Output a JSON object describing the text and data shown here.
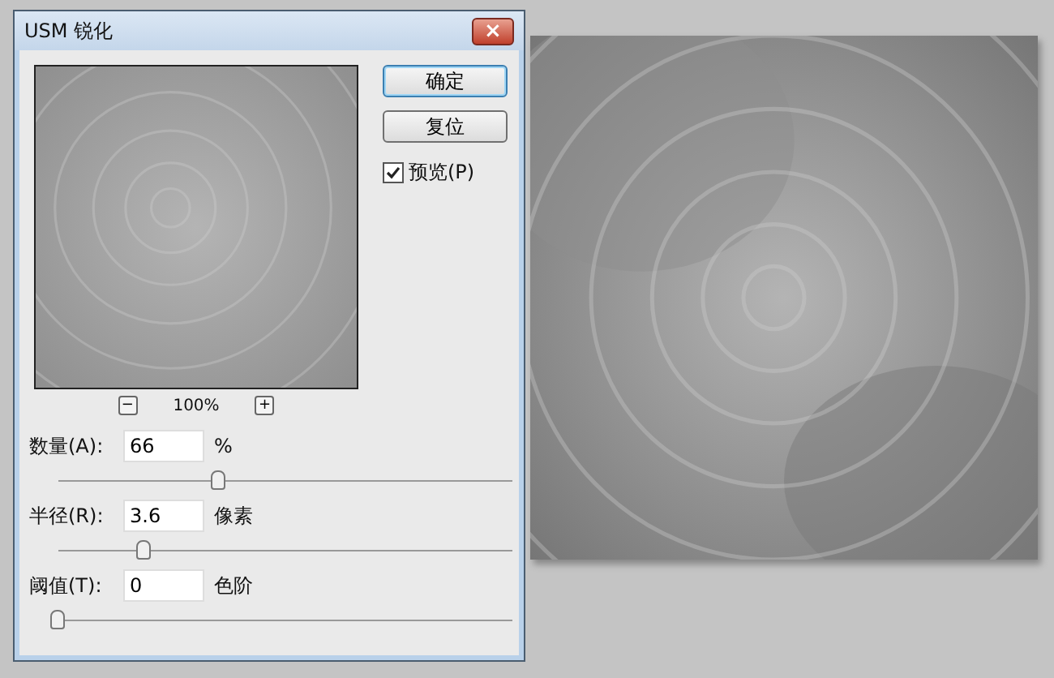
{
  "window": {
    "title": "USM 锐化",
    "close": "×"
  },
  "buttons": [
    {
      "label": "确定",
      "default": true
    },
    {
      "label": "复位",
      "default": false
    }
  ],
  "preview_option": {
    "label": "预览(P)",
    "checked": true
  },
  "zoom": {
    "minus": "−",
    "value": "100%",
    "plus": "+"
  },
  "params": [
    {
      "label": "数量(A):",
      "value": "66",
      "unit": "%",
      "level": 0.354
    },
    {
      "label": "半径(R):",
      "value": "3.6",
      "unit": "像素",
      "level": 0.19
    },
    {
      "label": "阈值(T):",
      "value": "0",
      "unit": "色阶",
      "level": 0.0
    }
  ]
}
